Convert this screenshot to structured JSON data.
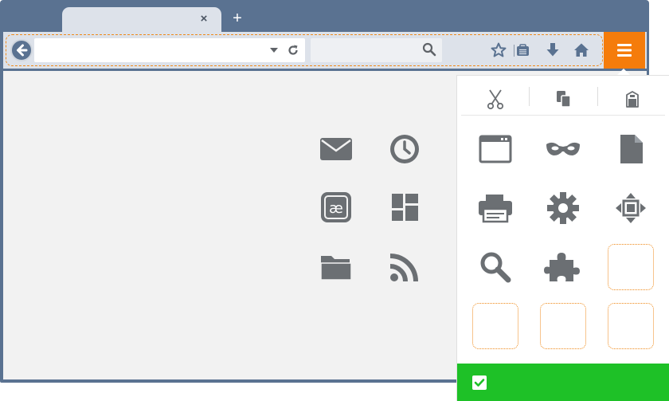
{
  "tab": {
    "title": "",
    "close_glyph": "×"
  },
  "new_tab_glyph": "+",
  "url_bar": {
    "value": "",
    "placeholder": ""
  },
  "search_bar": {
    "value": "",
    "placeholder": ""
  },
  "toolbar_buttons": [
    "back-icon",
    "dropdown-icon",
    "reload-icon",
    "search-icon",
    "bookmark-star-icon",
    "bookmarks-list-icon",
    "download-icon",
    "home-icon",
    "menu-icon"
  ],
  "content_icons": [
    "mail-icon",
    "history-clock-icon",
    "character-encoding-icon",
    "tab-groups-icon",
    "folder-icon",
    "rss-feed-icon"
  ],
  "character_encoding_glyph": "æ",
  "menu_panel": {
    "edit_controls": [
      "cut-icon",
      "copy-icon",
      "paste-icon"
    ],
    "items": [
      "new-window-icon",
      "private-window-icon",
      "page-icon",
      "print-icon",
      "settings-gear-icon",
      "fullscreen-icon",
      "find-icon",
      "addons-puzzle-icon"
    ],
    "empty_slots": 4,
    "footer_checkbox_checked": true
  },
  "colors": {
    "frame": "#5a7291",
    "toolbar": "#dde2ea",
    "accent_orange": "#f57c0b",
    "dashed_orange": "#ef8a1b",
    "footer_green": "#1ec127",
    "icon_gray": "#6b6f73"
  }
}
